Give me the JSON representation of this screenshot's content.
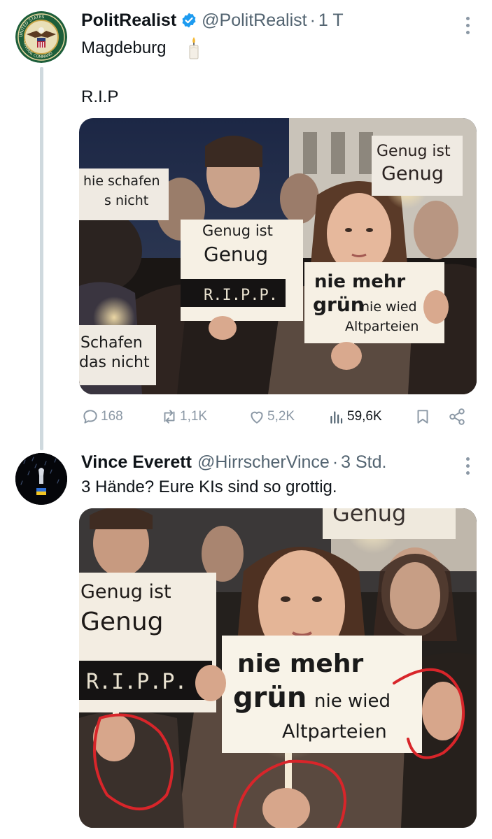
{
  "thread": {
    "posts": [
      {
        "display_name": "PolitRealist",
        "handle": "@PolitRealist",
        "separator": "·",
        "time": "1 T",
        "text_line1": "Magdeburg",
        "text_line2": "R.I.P",
        "image_signs": {
          "left_top_1": "hie schafen",
          "left_top_2": "s nicht",
          "center_1": "Genug ist",
          "center_2": "Genug",
          "center_3": "R.I.P.P.",
          "right_top_1": "Genug ist",
          "right_top_2": "Genug",
          "right_1": "nie mehr",
          "right_2": "grün",
          "right_3": "nie wied",
          "right_4": "Altparteien",
          "left_bottom_1": "Schafen",
          "left_bottom_2": "das nicht"
        },
        "actions": {
          "replies": "168",
          "reposts": "1,1K",
          "likes": "5,2K",
          "views": "59,6K"
        }
      },
      {
        "display_name": "Vince Everett",
        "handle": "@HirrscherVince",
        "separator": "·",
        "time": "3 Std.",
        "text": "3 Hände? Eure KIs sind so grottig.",
        "image_signs": {
          "top": "Genug",
          "left_1": "Genug ist",
          "left_2": "Genug",
          "left_3": "R.I.P.P.",
          "center_1": "nie mehr",
          "center_2": "grün",
          "center_3": "nie wied",
          "center_4": "Altparteien"
        }
      }
    ]
  },
  "colors": {
    "verified_blue": "#1d9bf0",
    "muted_text": "#536471",
    "annotation_red": "#d8252a"
  },
  "icons": [
    "reply-icon",
    "repost-icon",
    "like-icon",
    "views-icon",
    "bookmark-icon",
    "share-icon",
    "more-icon",
    "verified-badge-icon",
    "candle-emoji-icon"
  ]
}
